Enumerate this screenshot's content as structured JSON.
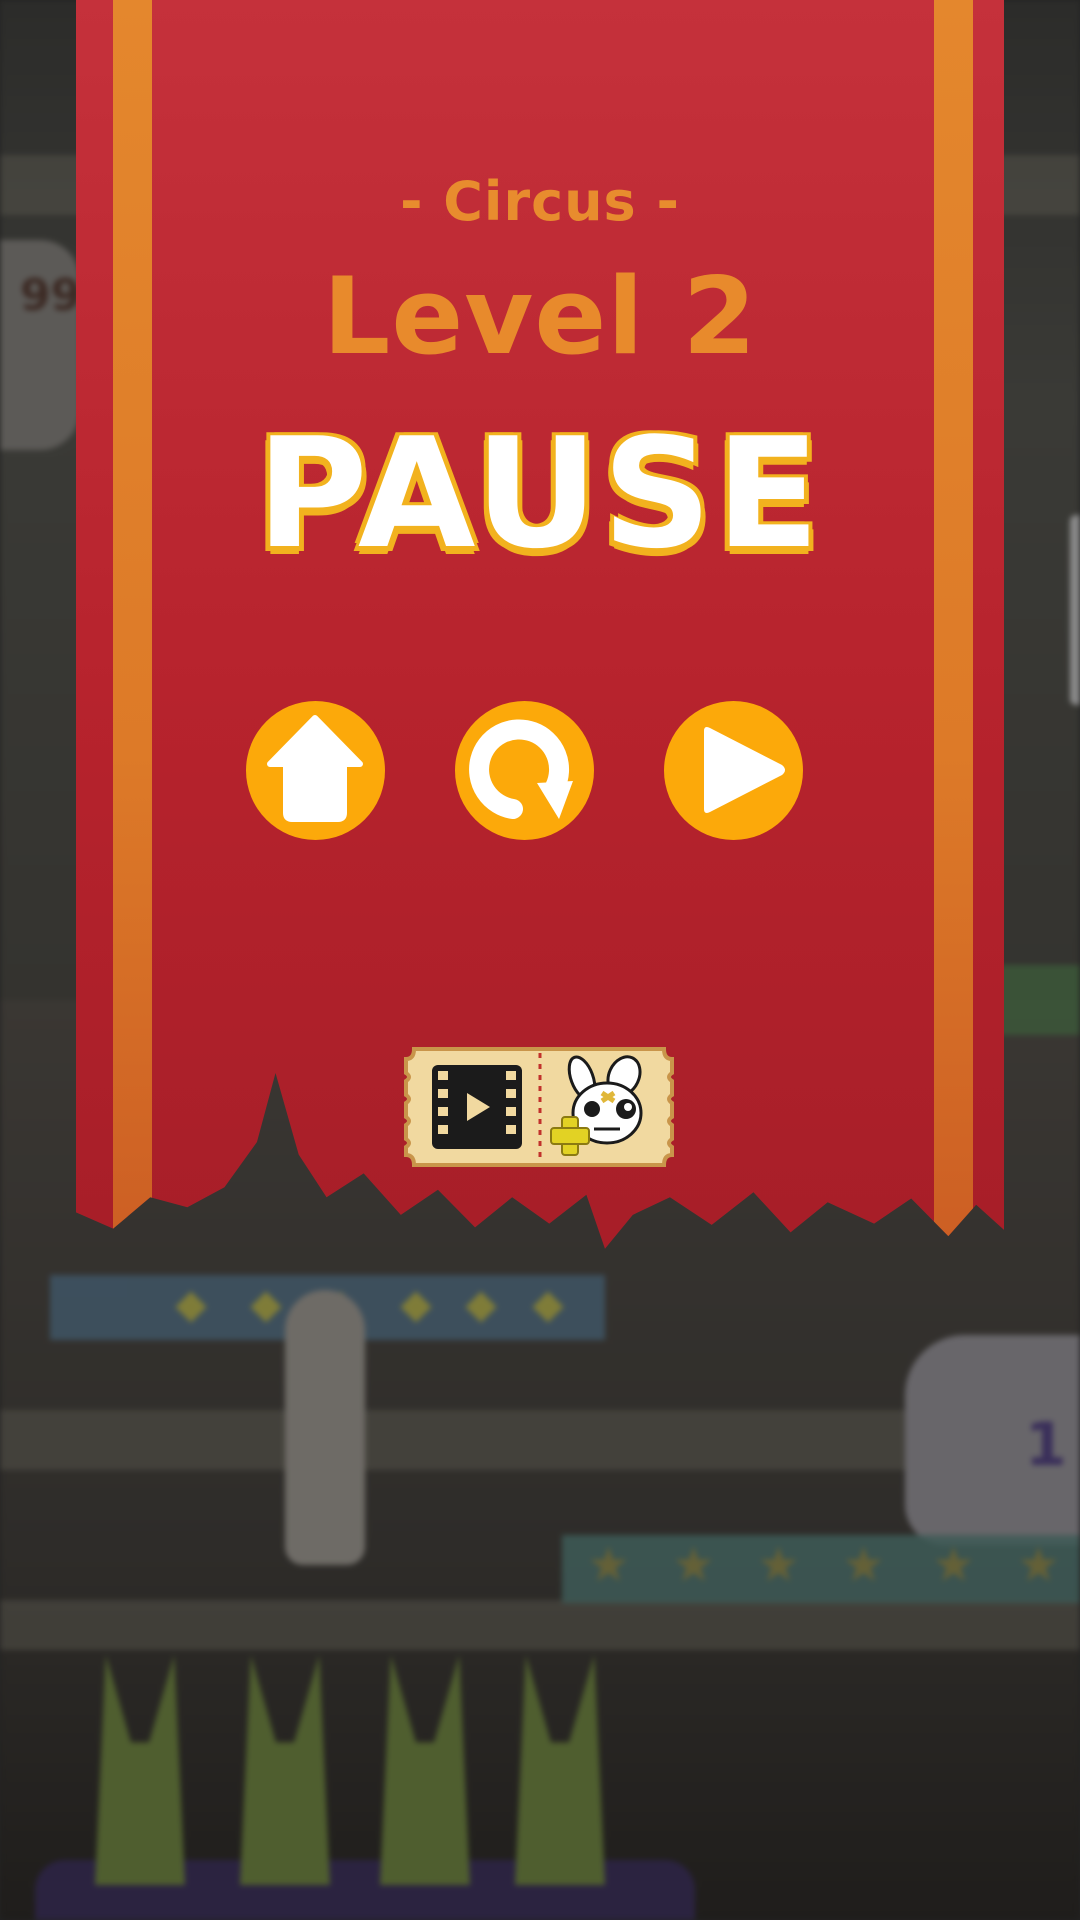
{
  "screen": {
    "subtitle": "- Circus -",
    "level_title": "Level 2",
    "pause_title": "PAUSE"
  },
  "buttons": [
    {
      "id": "home",
      "icon": "home-icon"
    },
    {
      "id": "restart",
      "icon": "restart-icon"
    },
    {
      "id": "resume",
      "icon": "play-icon"
    }
  ],
  "reward_ticket": {
    "icons": [
      "video-ad-icon",
      "add-character-icon"
    ]
  },
  "background": {
    "hat_numbers": [
      "99",
      "1"
    ]
  },
  "colors": {
    "banner_red": "#c22c35",
    "banner_stripe": "#e4872d",
    "title_orange": "#e88a2c",
    "pause_outline": "#f2b21e",
    "button_orange": "#fca90a",
    "ticket_cream": "#f1d9a0"
  }
}
